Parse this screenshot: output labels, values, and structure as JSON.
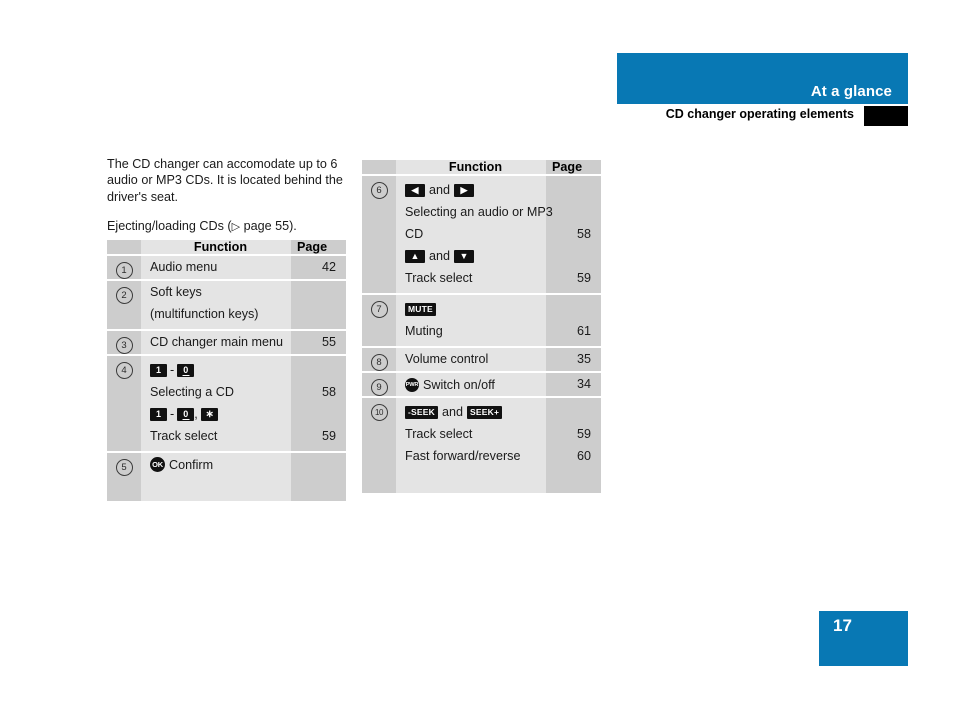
{
  "header": {
    "band_title": "At a glance",
    "subtitle": "CD changer operating elements",
    "band_color": "#0878b4",
    "tab_color": "#000000"
  },
  "intro": {
    "paragraph1": "The CD changer can accomodate up to 6 audio or MP3 CDs. It is located behind the driver's seat.",
    "paragraph2_pre": "Ejecting/loading CDs (",
    "paragraph2_arrow": "▷",
    "paragraph2_post": " page 55)."
  },
  "tables": {
    "columns": {
      "num": "",
      "function": "Function",
      "page": "Page"
    },
    "left_rows": [
      {
        "num": "1",
        "lines": [
          {
            "text": "Audio menu",
            "page": "42"
          }
        ]
      },
      {
        "num": "2",
        "lines": [
          {
            "text": "Soft keys",
            "page": ""
          },
          {
            "text": "(multifunction keys)",
            "page": ""
          }
        ]
      },
      {
        "num": "3",
        "lines": [
          {
            "text": "CD changer main menu",
            "page": "55"
          }
        ]
      },
      {
        "num": "4",
        "keys_a": {
          "k1": "1",
          "sep": "-",
          "k2": "0"
        },
        "lines": [
          {
            "text": "Selecting a CD",
            "page": "58"
          }
        ],
        "keys_b": {
          "k1": "1",
          "sep": "-",
          "k2": "0",
          "comma": ",",
          "k3": "∗"
        },
        "lines2": [
          {
            "text": "Track select",
            "page": "59"
          }
        ]
      },
      {
        "num": "5",
        "ok_icon": "OK",
        "lines": [
          {
            "text": "Confirm",
            "page": ""
          }
        ]
      }
    ],
    "right_rows": [
      {
        "num": "6",
        "keys_a": {
          "k1": "◀",
          "conj": "and",
          "k2": "▶"
        },
        "lines": [
          {
            "text": "Selecting an audio or MP3",
            "page": ""
          },
          {
            "text": "CD",
            "page": "58"
          }
        ],
        "keys_b": {
          "k1": "▲",
          "conj": "and",
          "k2": "▼"
        },
        "lines2": [
          {
            "text": "Track select",
            "page": "59"
          }
        ]
      },
      {
        "num": "7",
        "mute_key": "MUTE",
        "lines": [
          {
            "text": "Muting",
            "page": "61"
          }
        ]
      },
      {
        "num": "8",
        "lines": [
          {
            "text": "Volume control",
            "page": "35"
          }
        ]
      },
      {
        "num": "9",
        "pwr_icon": "PWR",
        "lines": [
          {
            "text": "Switch on/off",
            "page": "34"
          }
        ]
      },
      {
        "num": "10",
        "keys_a": {
          "k1": "-SEEK",
          "conj": "and",
          "k2": "SEEK+"
        },
        "lines": [
          {
            "text": "Track select",
            "page": "59"
          },
          {
            "text": "Fast forward/reverse",
            "page": "60"
          }
        ]
      }
    ]
  },
  "footer": {
    "page_number": "17",
    "page_box_color": "#0878b4"
  }
}
